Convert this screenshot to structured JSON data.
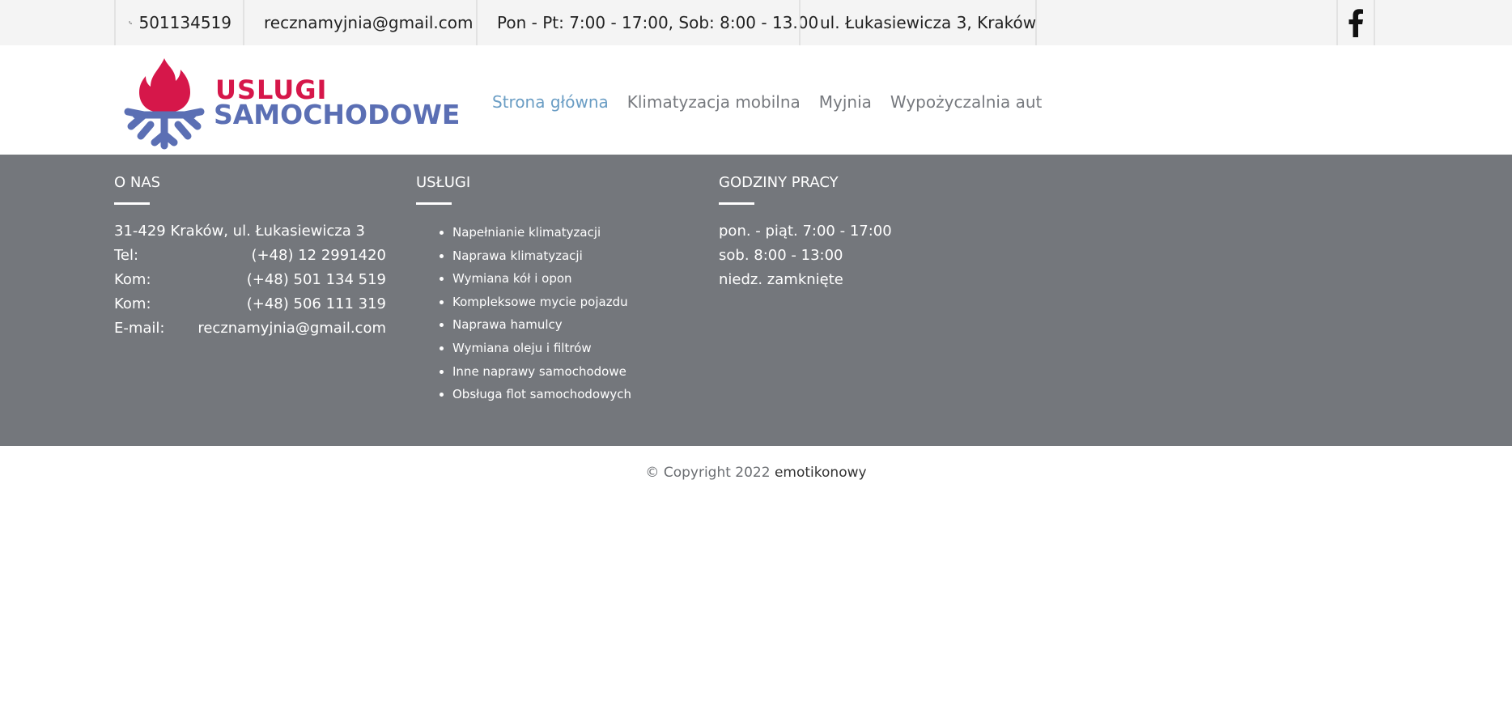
{
  "topbar": {
    "phone": "501134519",
    "email": "recznamyjnia@gmail.com",
    "hours": "Pon - Pt: 7:00 - 17:00, Sob: 8:00 - 13.00",
    "address": "ul. Łukasiewicza 3, Kraków",
    "icons": [
      "phone-icon",
      "mail-icon",
      "clock-icon",
      "location-pin-icon",
      "facebook-icon"
    ]
  },
  "header": {
    "logo_line1": "USLUGI",
    "logo_line2": "SAMOCHODOWE",
    "nav": [
      {
        "label": "Strona główna",
        "active": true
      },
      {
        "label": "Klimatyzacja mobilna",
        "active": false
      },
      {
        "label": "Myjnia",
        "active": false
      },
      {
        "label": "Wypożyczalnia aut",
        "active": false
      }
    ],
    "colors": {
      "nav_active": "#6a9dc4",
      "nav": "#777a7f",
      "logo_red": "#d6174a",
      "logo_blue": "#5b6fb4"
    }
  },
  "footer": {
    "about": {
      "title": "O NAS",
      "address": "31-429 Kraków, ul. Łukasiewicza 3",
      "rows": [
        {
          "label": "Tel:",
          "value": "(+48) 12 2991420"
        },
        {
          "label": "Kom:",
          "value": "(+48) 501 134 519"
        },
        {
          "label": "Kom:",
          "value": "(+48) 506 111 319"
        },
        {
          "label": "E-mail:",
          "value": "recznamyjnia@gmail.com"
        }
      ]
    },
    "services": {
      "title": "USŁUGI",
      "items": [
        "Napełnianie klimatyzacji",
        "Naprawa klimatyzacji",
        "Wymiana kół i opon",
        "Kompleksowe mycie pojazdu",
        "Naprawa hamulcy",
        "Wymiana oleju i filtrów",
        "Inne naprawy samochodowe",
        "Obsługa flot samochodowych"
      ]
    },
    "hours": {
      "title": "GODZINY PRACY",
      "lines": [
        "pon. - piąt. 7:00 - 17:00",
        "sob. 8:00 - 13:00",
        "niedz. zamknięte"
      ]
    },
    "background": "#74777c"
  },
  "copyright": {
    "text": "© Copyright 2022",
    "brand": "emotikonowy"
  }
}
